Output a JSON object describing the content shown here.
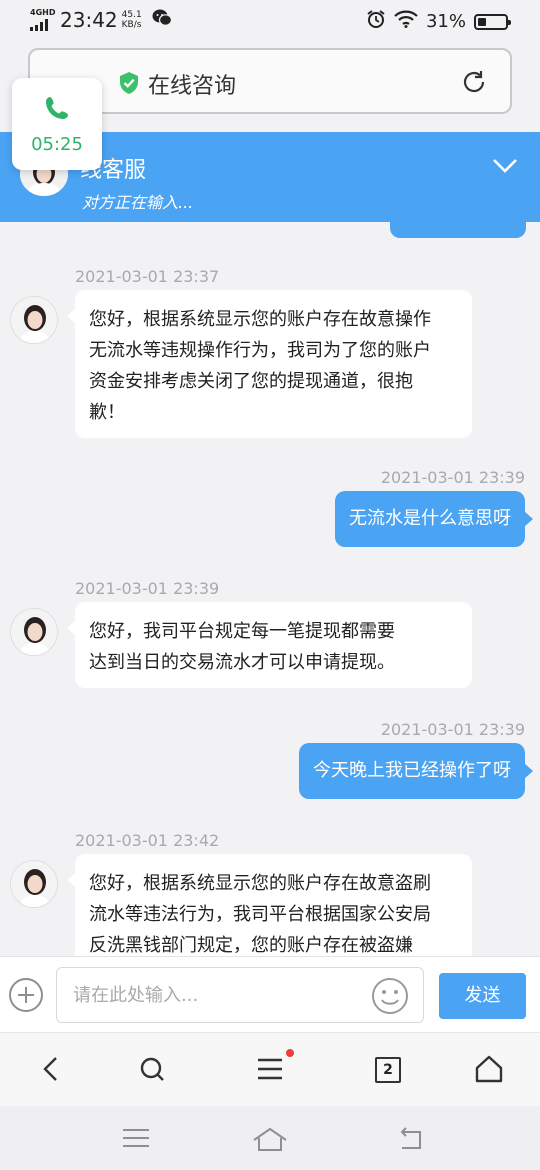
{
  "status_bar": {
    "network": "4GHD",
    "time": "23:42",
    "speed_value": "45.1",
    "speed_unit": "KB/s",
    "battery_percent": "31%",
    "battery_level": 0.31
  },
  "browser": {
    "page_title": "在线咨询"
  },
  "call": {
    "duration": "05:25"
  },
  "chat_header": {
    "title": "线客服",
    "subtitle": "对方正在输入..."
  },
  "messages": [
    {
      "from": "agent",
      "time": "2021-03-01 23:37",
      "lines": [
        "您好，根据系统显示您的账户存在故意操作",
        "无流水等违规操作行为，我司为了您的账户",
        "资金安排考虑关闭了您的提现通道，很抱",
        "歉！"
      ]
    },
    {
      "from": "user",
      "time": "2021-03-01 23:39",
      "text": "无流水是什么意思呀"
    },
    {
      "from": "agent",
      "time": "2021-03-01 23:39",
      "lines": [
        "您好，我司平台规定每一笔提现都需要",
        "达到当日的交易流水才可以申请提现。"
      ]
    },
    {
      "from": "user",
      "time": "2021-03-01 23:39",
      "text": "今天晚上我已经操作了呀"
    },
    {
      "from": "agent",
      "time": "2021-03-01 23:42",
      "lines": [
        "您好，根据系统显示您的账户存在故意盗刷",
        "流水等违法行为，我司平台根据国家公安局",
        "反洗黑钱部门规定，您的账户存在被盗嫌"
      ]
    }
  ],
  "input": {
    "placeholder": "请在此处输入...",
    "send_label": "发送"
  },
  "browser_nav": {
    "tab_count": "2"
  },
  "colors": {
    "accent": "#4ba3f4",
    "call_green": "#2fb36b",
    "notif_red": "#f23b3b"
  }
}
